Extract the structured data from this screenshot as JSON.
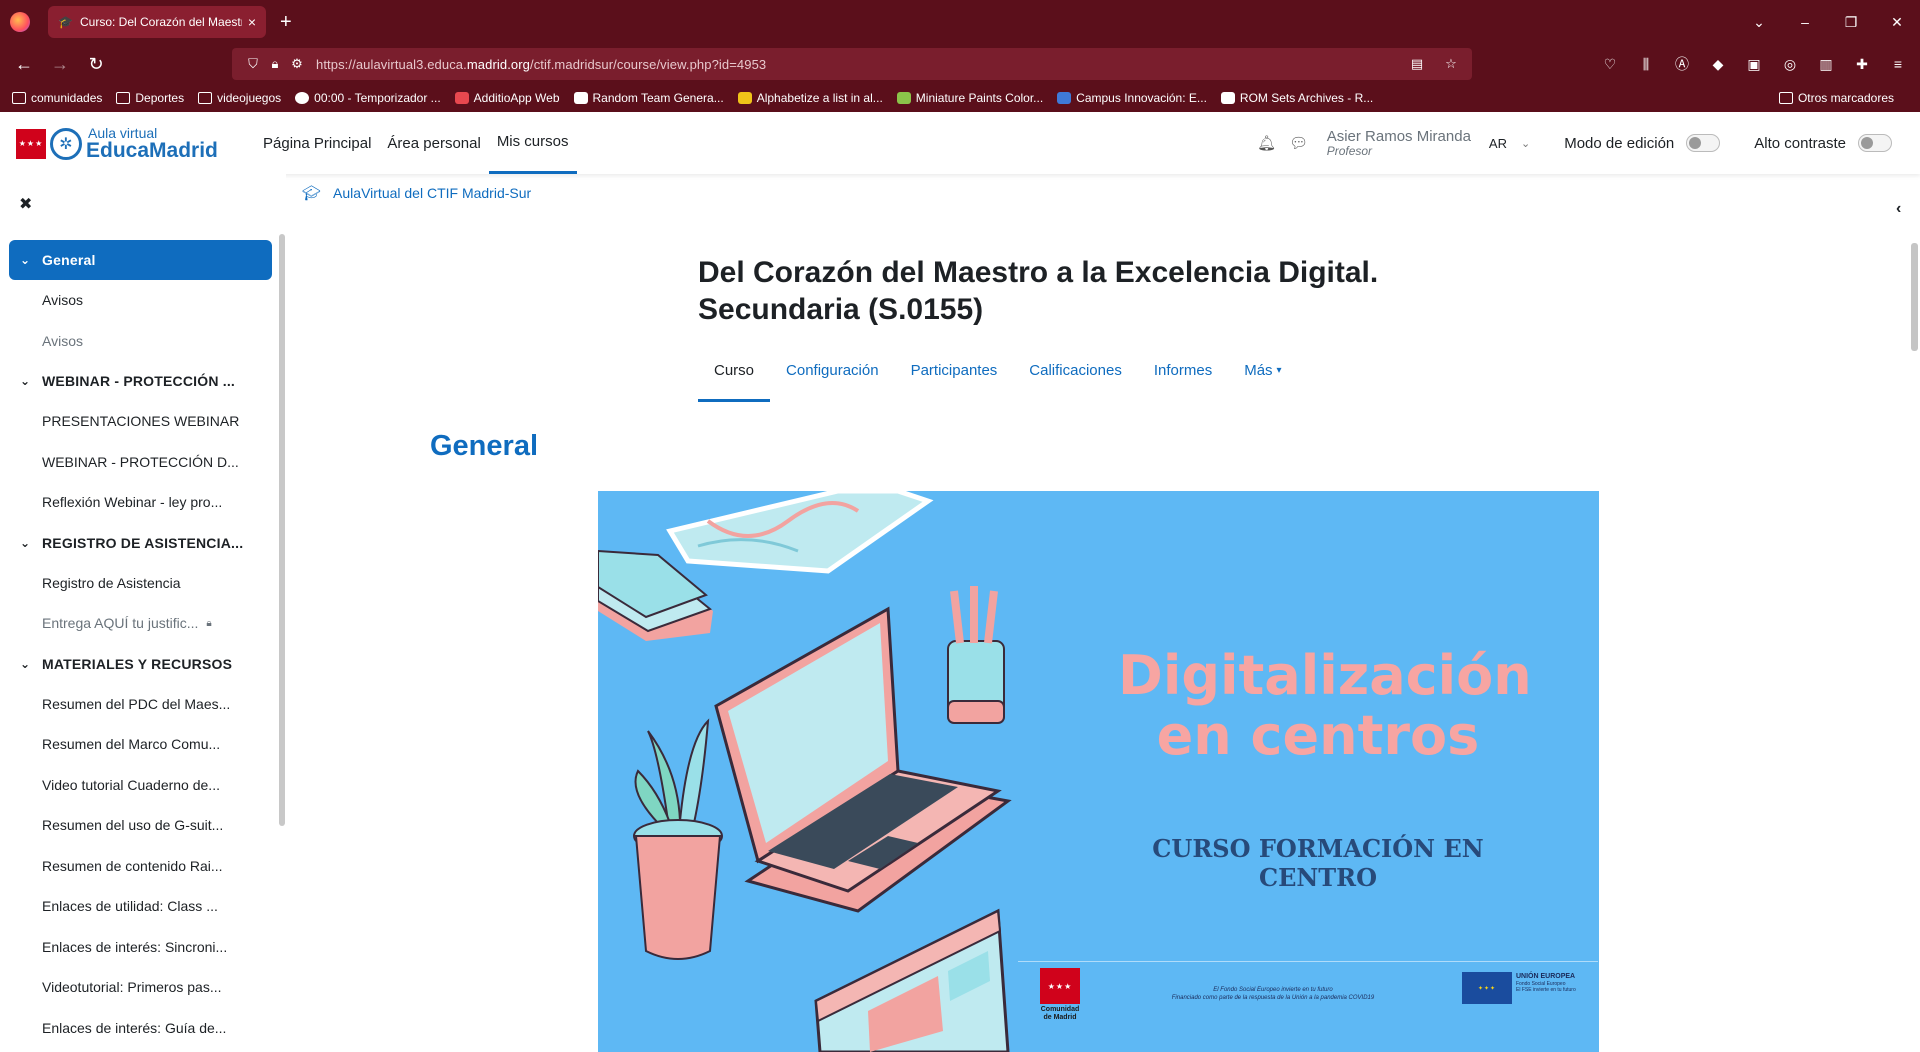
{
  "browser": {
    "tab_title": "Curso: Del Corazón del Maestro a la Excelencia Digital",
    "tab_close": "×",
    "new_tab": "+",
    "url_prefix": "https://aulavirtual3.educa.",
    "url_domain": "madrid.org",
    "url_path": "/ctif.madridsur/course/view.php?id=4953",
    "window_controls": [
      "⌄",
      "–",
      "❐",
      "✕"
    ],
    "bookmarks": [
      {
        "label": "comunidades",
        "icon": "folder-icon"
      },
      {
        "label": "Deportes",
        "icon": "folder-icon"
      },
      {
        "label": "videojuegos",
        "icon": "folder-icon"
      },
      {
        "label": "00:00 - Temporizador ...",
        "icon": "timer-icon"
      },
      {
        "label": "AdditioApp Web",
        "icon": "additio-icon"
      },
      {
        "label": "Random Team Genera...",
        "icon": "dice-icon"
      },
      {
        "label": "Alphabetize a list in al...",
        "icon": "alphabet-icon"
      },
      {
        "label": "Miniature Paints Color...",
        "icon": "paint-icon"
      },
      {
        "label": "Campus Innovación: E...",
        "icon": "campus-icon"
      },
      {
        "label": "ROM Sets Archives - R...",
        "icon": "rom-icon"
      }
    ],
    "other_bookmarks": "Otros marcadores"
  },
  "moodle_nav": {
    "brand_small": "Aula virtual",
    "brand_big": "EducaMadrid",
    "links": [
      {
        "label": "Página Principal",
        "active": false
      },
      {
        "label": "Área personal",
        "active": false
      },
      {
        "label": "Mis cursos",
        "active": true
      }
    ],
    "user_name": "Asier Ramos Miranda",
    "user_role": "Profesor",
    "avatar_initials": "AR",
    "edit_mode_label": "Modo de edición",
    "high_contrast_label": "Alto contraste"
  },
  "breadcrumb": "AulaVirtual del CTIF Madrid-Sur",
  "course": {
    "title_line1": "Del Corazón del Maestro a la Excelencia Digital.",
    "title_line2": "Secundaria (S.0155)",
    "tabs": [
      "Curso",
      "Configuración",
      "Participantes",
      "Calificaciones",
      "Informes",
      "Más"
    ],
    "active_tab": "Curso",
    "section_title": "General"
  },
  "course_index": [
    {
      "type": "section",
      "label": "General",
      "active": true
    },
    {
      "type": "item",
      "label": "Avisos",
      "dim": false
    },
    {
      "type": "item",
      "label": "Avisos",
      "dim": true
    },
    {
      "type": "section",
      "label": "WEBINAR - PROTECCIÓN ...",
      "active": false
    },
    {
      "type": "item",
      "label": "PRESENTACIONES WEBINAR",
      "dim": false
    },
    {
      "type": "item",
      "label": "WEBINAR - PROTECCIÓN D...",
      "dim": false
    },
    {
      "type": "item",
      "label": "Reflexión Webinar - ley pro...",
      "dim": false
    },
    {
      "type": "section",
      "label": "REGISTRO DE ASISTENCIA...",
      "active": false
    },
    {
      "type": "item",
      "label": "Registro de Asistencia",
      "dim": false
    },
    {
      "type": "item",
      "label": "Entrega AQUÍ tu justific...",
      "dim": true,
      "locked": true
    },
    {
      "type": "section",
      "label": "MATERIALES Y RECURSOS",
      "active": false
    },
    {
      "type": "item",
      "label": "Resumen del PDC del Maes...",
      "dim": false
    },
    {
      "type": "item",
      "label": "Resumen del Marco Comu...",
      "dim": false
    },
    {
      "type": "item",
      "label": "Video tutorial Cuaderno de...",
      "dim": false
    },
    {
      "type": "item",
      "label": "Resumen del uso de G-suit...",
      "dim": false
    },
    {
      "type": "item",
      "label": "Resumen de contenido Rai...",
      "dim": false
    },
    {
      "type": "item",
      "label": "Enlaces de utilidad: Class ...",
      "dim": false
    },
    {
      "type": "item",
      "label": "Enlaces de interés: Sincroni...",
      "dim": false
    },
    {
      "type": "item",
      "label": "Videotutorial: Primeros pas...",
      "dim": false
    },
    {
      "type": "item",
      "label": "Enlaces de interés: Guía de...",
      "dim": false
    }
  ],
  "banner": {
    "title_line1": "Digitalización",
    "title_line2": "en centros",
    "subtitle": "CURSO FORMACIÓN EN CENTRO",
    "cm_label": "Comunidad de Madrid",
    "fse_line1": "El Fondo Social Europeo invierte en tu futuro",
    "fse_line2": "Financiado como parte de la respuesta de la Unión a la pandemia COVID19",
    "eu_label": "UNIÓN EUROPEA",
    "eu_sub": "Fondo Social Europeo",
    "eu_small": "El FSE invierte en tu futuro"
  },
  "colors": {
    "browser_chrome": "#5b0f1b",
    "moodle_primary": "#0f6cbf",
    "banner_bg": "#5eb8f4",
    "banner_title": "#f7a5a2",
    "banner_subtitle": "#274a7a"
  }
}
